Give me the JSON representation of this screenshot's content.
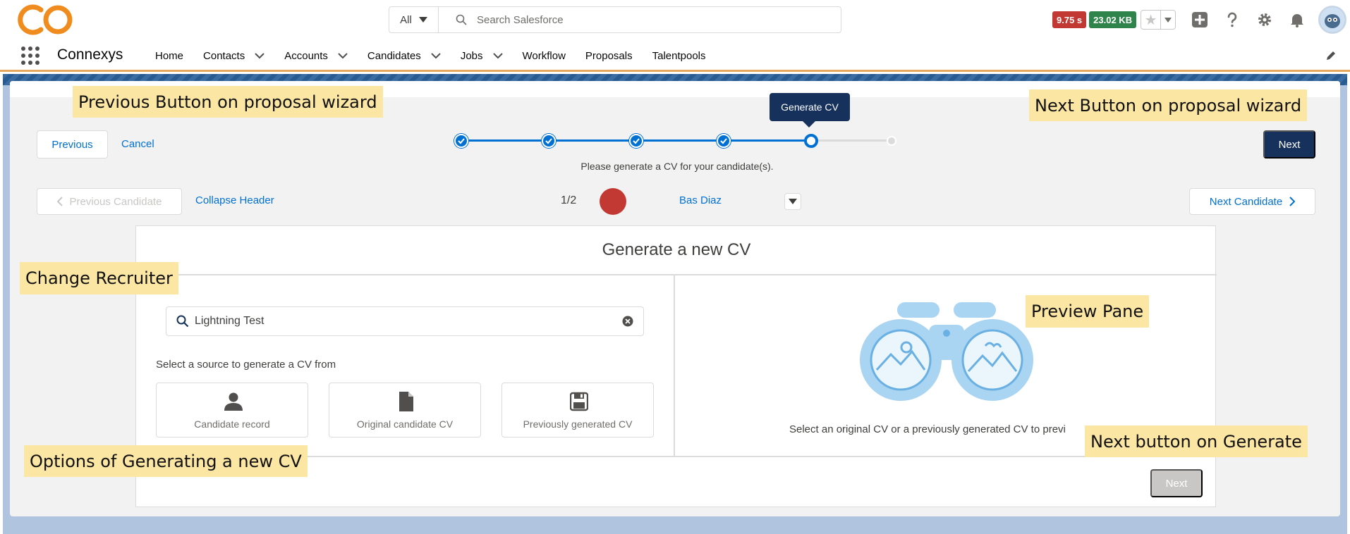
{
  "header": {
    "search_scope": "All",
    "search_placeholder": "Search Salesforce",
    "perf_time": "9.75 s",
    "perf_size": "23.02 KB"
  },
  "nav": {
    "app_name": "Connexys",
    "items": [
      {
        "label": "Home",
        "has_menu": false
      },
      {
        "label": "Contacts",
        "has_menu": true
      },
      {
        "label": "Accounts",
        "has_menu": true
      },
      {
        "label": "Candidates",
        "has_menu": true
      },
      {
        "label": "Jobs",
        "has_menu": true
      },
      {
        "label": "Workflow",
        "has_menu": false
      },
      {
        "label": "Proposals",
        "has_menu": false
      },
      {
        "label": "Talentpools",
        "has_menu": false
      }
    ]
  },
  "wizard": {
    "previous_label": "Previous",
    "cancel_label": "Cancel",
    "next_label": "Next",
    "current_step_tooltip": "Generate CV",
    "instruction": "Please generate a CV for your candidate(s).",
    "steps_total": 6,
    "steps_completed": 4,
    "current_step": 5
  },
  "candidate_bar": {
    "previous_candidate_label": "Previous Candidate",
    "collapse_header_label": "Collapse Header",
    "counter": "1/2",
    "candidate_name": "Bas Diaz",
    "next_candidate_label": "Next Candidate"
  },
  "generate": {
    "title": "Generate a new CV",
    "recruiter_value": "Lightning Test",
    "source_label": "Select a source to generate a CV from",
    "sources": [
      {
        "label": "Candidate record",
        "icon": "person-icon"
      },
      {
        "label": "Original candidate CV",
        "icon": "document-icon"
      },
      {
        "label": "Previously generated CV",
        "icon": "save-icon"
      }
    ],
    "preview_text": "Select an original CV or a previously generated CV to previ",
    "next_label": "Next"
  },
  "annotations": {
    "previous": "Previous Button on proposal wizard",
    "next": "Next Button on proposal wizard",
    "recruiter": "Change Recruiter",
    "preview": "Preview Pane",
    "options": "Options of Generating a new CV",
    "generate_next": "Next button on Generate"
  },
  "colors": {
    "brand": "#16325c",
    "link": "#0070d2",
    "accent_border": "#e8a75f",
    "callout": "#fbe6a4",
    "perf_bad": "#c23934",
    "perf_good": "#2e844a",
    "avatar_red": "#c23934"
  }
}
